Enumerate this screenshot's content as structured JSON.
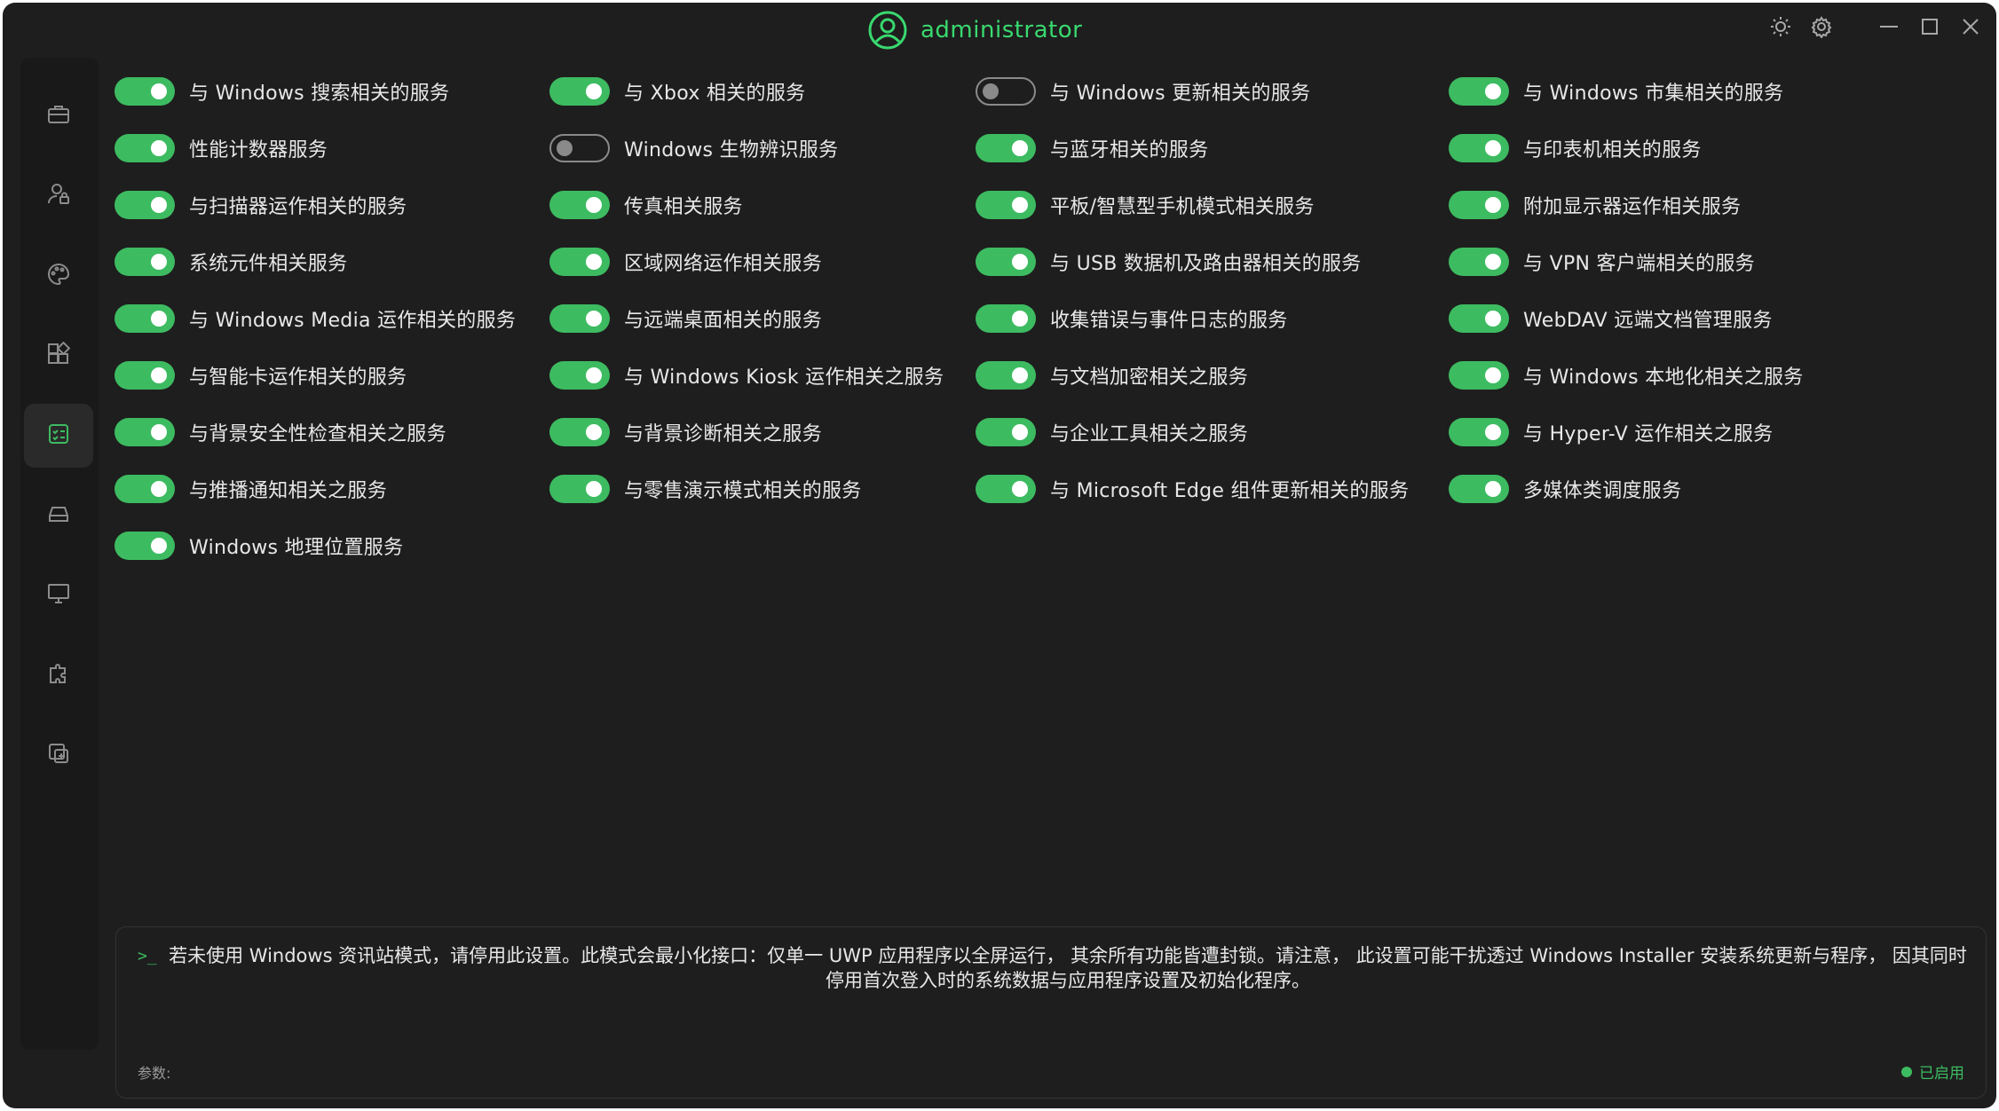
{
  "app": {
    "user_name": "administrator",
    "accent_color": "#3dbb61"
  },
  "title_controls": [
    "theme-icon",
    "settings-icon",
    "minimize-icon",
    "maximize-icon",
    "close-icon"
  ],
  "sidebar": {
    "items": [
      {
        "icon": "toolbox-icon",
        "active": false
      },
      {
        "icon": "user-lock-icon",
        "active": false
      },
      {
        "icon": "palette-icon",
        "active": false
      },
      {
        "icon": "apps-icon",
        "active": false
      },
      {
        "icon": "services-checklist-icon",
        "active": true
      },
      {
        "icon": "drive-icon",
        "active": false
      },
      {
        "icon": "monitor-icon",
        "active": false
      },
      {
        "icon": "gear-puzzle-icon",
        "active": false
      },
      {
        "icon": "backup-icon",
        "active": false
      }
    ]
  },
  "services": {
    "columns": [
      [
        {
          "label": "与 Windows 搜索相关的服务",
          "enabled": true
        },
        {
          "label": "性能计数器服务",
          "enabled": true
        },
        {
          "label": "与扫描器运作相关的服务",
          "enabled": true
        },
        {
          "label": "系统元件相关服务",
          "enabled": true
        },
        {
          "label": "与 Windows Media 运作相关的服务",
          "enabled": true
        },
        {
          "label": "与智能卡运作相关的服务",
          "enabled": true
        },
        {
          "label": "与背景安全性检查相关之服务",
          "enabled": true
        },
        {
          "label": "与推播通知相关之服务",
          "enabled": true
        },
        {
          "label": "Windows 地理位置服务",
          "enabled": true
        }
      ],
      [
        {
          "label": "与 Xbox 相关的服务",
          "enabled": true
        },
        {
          "label": "Windows 生物辨识服务",
          "enabled": false
        },
        {
          "label": "传真相关服务",
          "enabled": true
        },
        {
          "label": "区域网络运作相关服务",
          "enabled": true
        },
        {
          "label": "与远端桌面相关的服务",
          "enabled": true
        },
        {
          "label": "与 Windows Kiosk 运作相关之服务",
          "enabled": true
        },
        {
          "label": "与背景诊断相关之服务",
          "enabled": true
        },
        {
          "label": "与零售演示模式相关的服务",
          "enabled": true
        }
      ],
      [
        {
          "label": "与 Windows 更新相关的服务",
          "enabled": false
        },
        {
          "label": "与蓝牙相关的服务",
          "enabled": true
        },
        {
          "label": "平板/智慧型手机模式相关服务",
          "enabled": true
        },
        {
          "label": "与 USB 数据机及路由器相关的服务",
          "enabled": true
        },
        {
          "label": "收集错误与事件日志的服务",
          "enabled": true
        },
        {
          "label": "与文档加密相关之服务",
          "enabled": true
        },
        {
          "label": "与企业工具相关之服务",
          "enabled": true
        },
        {
          "label": "与 Microsoft Edge 组件更新相关的服务",
          "enabled": true
        }
      ],
      [
        {
          "label": "与 Windows 市集相关的服务",
          "enabled": true
        },
        {
          "label": "与印表机相关的服务",
          "enabled": true
        },
        {
          "label": "附加显示器运作相关服务",
          "enabled": true
        },
        {
          "label": "与 VPN 客户端相关的服务",
          "enabled": true
        },
        {
          "label": "WebDAV 远端文档管理服务",
          "enabled": true
        },
        {
          "label": "与 Windows 本地化相关之服务",
          "enabled": true
        },
        {
          "label": "与 Hyper-V 运作相关之服务",
          "enabled": true
        },
        {
          "label": "多媒体类调度服务",
          "enabled": true
        }
      ]
    ]
  },
  "info_panel": {
    "prompt": ">_",
    "description": "若未使用 Windows 资讯站模式，请停用此设置。此模式会最小化接口：仅单一 UWP 应用程序以全屏运行， 其余所有功能皆遭封锁。请注意， 此设置可能干扰透过 Windows Installer 安装系统更新与程序， 因其同时停用首次登入时的系统数据与应用程序设置及初始化程序。",
    "param_label": "参数:",
    "status_text": "已启用"
  }
}
